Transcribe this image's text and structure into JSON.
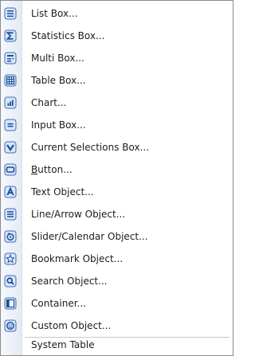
{
  "menu": {
    "items": [
      {
        "label": "List Box...",
        "icon": "list-box-icon"
      },
      {
        "label": "Statistics Box...",
        "icon": "statistics-box-icon"
      },
      {
        "label": "Multi Box...",
        "icon": "multi-box-icon"
      },
      {
        "label": "Table Box...",
        "icon": "table-box-icon"
      },
      {
        "label": "Chart...",
        "icon": "chart-icon"
      },
      {
        "label": "Input Box...",
        "icon": "input-box-icon"
      },
      {
        "label": "Current Selections Box...",
        "icon": "current-selections-icon"
      },
      {
        "label_accel": "B",
        "label_rest": "utton...",
        "icon": "button-icon"
      },
      {
        "label": "Text Object...",
        "icon": "text-object-icon"
      },
      {
        "label": "Line/Arrow Object...",
        "icon": "line-arrow-icon"
      },
      {
        "label": "Slider/Calendar Object...",
        "icon": "slider-calendar-icon"
      },
      {
        "label": "Bookmark Object...",
        "icon": "bookmark-icon"
      },
      {
        "label": "Search Object...",
        "icon": "search-icon"
      },
      {
        "label": "Container...",
        "icon": "container-icon"
      },
      {
        "label": "Custom Object...",
        "icon": "custom-object-icon"
      },
      {
        "label": "System Table"
      }
    ]
  },
  "colors": {
    "icon_fill": "#d9e6f7",
    "icon_border": "#3a6fb8",
    "icon_glyph": "#1f4f99",
    "gutter": "#e8eef7"
  }
}
